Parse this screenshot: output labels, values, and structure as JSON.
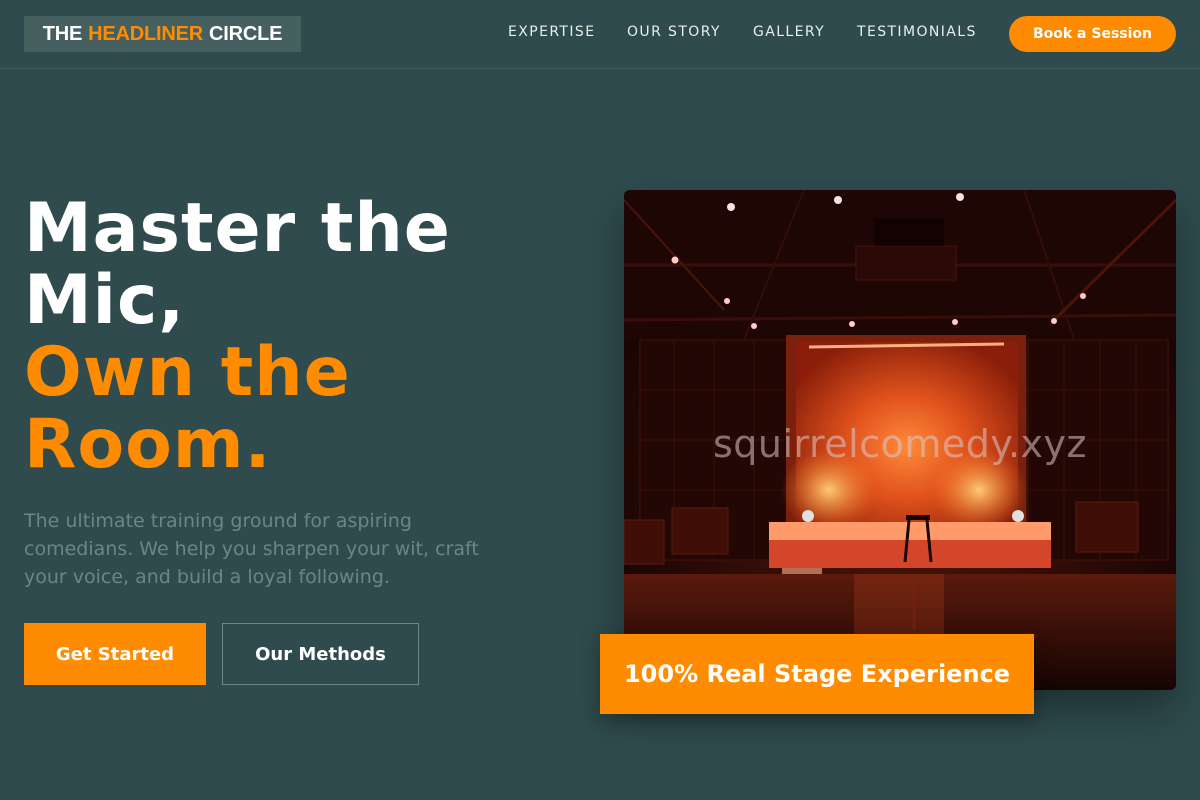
{
  "header": {
    "logo": {
      "part1": "THE",
      "part2": "HEADLINER",
      "part3": "CIRCLE"
    },
    "nav": [
      "EXPERTISE",
      "OUR STORY",
      "GALLERY",
      "TESTIMONIALS"
    ],
    "cta": "Book a Session"
  },
  "hero": {
    "headline_line1": "Master the",
    "headline_line2": "Mic,",
    "headline_line3": "Own the",
    "headline_line4": "Room.",
    "subtext": "The ultimate training ground for aspiring comedians. We help you sharpen your wit, craft your voice, and build a loyal following.",
    "primary_button": "Get Started",
    "secondary_button": "Our Methods"
  },
  "photo": {
    "watermark": "squirrelcomedy.xyz",
    "badge": "100% Real Stage Experience"
  },
  "colors": {
    "background": "#2f4b4d",
    "accent": "#ff8c00",
    "muted_text": "#6d8588"
  }
}
